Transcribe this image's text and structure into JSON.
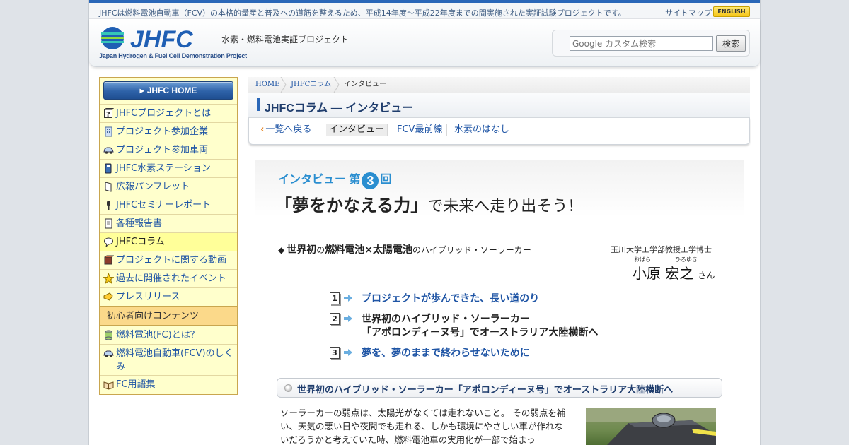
{
  "topbar": {
    "lead": "JHFCは燃料電池自動車（FCV）の本格的量産と普及への道筋を整えるため、平成14年度～平成22年度までの間実施された実証試験プロジェクトです。",
    "sitemap": "サイトマップ",
    "english": "ENGLISH"
  },
  "header": {
    "logo_text": "JHFC",
    "logo_sub": "Japan Hydrogen & Fuel Cell Demonstration Project",
    "logo_jp": "水素・燃料電池実証プロジェクト",
    "search_placeholder": "Google カスタム検索",
    "search_button": "検索"
  },
  "sidebar": {
    "home": "JHFC HOME",
    "items": [
      {
        "label": "JHFCプロジェクトとは",
        "icon": "question-cube-icon"
      },
      {
        "label": "プロジェクト参加企業",
        "icon": "building-icon"
      },
      {
        "label": "プロジェクト参加車両",
        "icon": "car-icon"
      },
      {
        "label": "JHFC水素ステーション",
        "icon": "station-icon"
      },
      {
        "label": "広報パンフレット",
        "icon": "pamphlet-icon"
      },
      {
        "label": "JHFCセミナーレポート",
        "icon": "microphone-icon"
      },
      {
        "label": "各種報告書",
        "icon": "document-icon"
      },
      {
        "label": "JHFCコラム",
        "icon": "speech-bubble-icon"
      },
      {
        "label": "プロジェクトに関する動画",
        "icon": "video-cube-icon"
      },
      {
        "label": "過去に開催されたイベント",
        "icon": "star-icon"
      },
      {
        "label": "プレスリリース",
        "icon": "megaphone-icon"
      }
    ],
    "section": "初心者向けコンテンツ",
    "beginner_items": [
      {
        "label": "燃料電池(FC)とは？",
        "icon": "fuel-cell-icon"
      },
      {
        "label": "燃料電池自動車(FCV)のしくみ",
        "icon": "car-icon"
      },
      {
        "label": "FC用語集",
        "icon": "book-icon"
      }
    ]
  },
  "breadcrumb": [
    "HOME",
    "JHFCコラム",
    "インタビュー"
  ],
  "page_title": "JHFCコラム ― インタビュー",
  "subnav": {
    "back": "一覧へ戻る",
    "items": [
      "インタビュー",
      "FCV最前線",
      "水素のはなし"
    ]
  },
  "banner": {
    "label_pre": "インタビュー 第",
    "number": "3",
    "label_post": "回",
    "headline_big": "「夢をかなえる力」",
    "headline_rest": "で未来へ走り出そう！"
  },
  "feature": {
    "marker": "◆",
    "part1": "世界初",
    "part2": "の",
    "part3": "燃料電池×太陽電池",
    "part4": "のハイブリッド・ソーラーカー"
  },
  "professor": {
    "title": "玉川大学工学部教授工学博士",
    "ruby_family": "おばら",
    "ruby_given": "ひろゆき",
    "name": "小原 宏之",
    "honorific": "さん"
  },
  "toc": [
    {
      "num": "1",
      "text": "プロジェクトが歩んできた、長い道のり",
      "link": true
    },
    {
      "num": "2",
      "text": "世界初のハイブリッド・ソーラーカー",
      "text2": "「アポロンディーヌ号」でオーストラリア大陸横断へ",
      "link": false
    },
    {
      "num": "3",
      "text": "夢を、夢のままで終わらせないために",
      "link": true
    }
  ],
  "section_heading": "世界初のハイブリッド・ソーラーカー「アポロンディーヌ号」でオーストラリア大陸横断へ",
  "body": "ソーラーカーの弱点は、太陽光がなくては走れないこと。 その弱点を補い、天気の悪い日や夜間でも走れる、しかも環境にやさしい車が作れないだろうかと考えていた時、燃料電池車の実用化が一部で始まっ",
  "colors": {
    "accent": "#2a67b8",
    "link": "#1f55a5",
    "sidebar_bg": "#ffffcc",
    "banner_blue": "#2a8ed0"
  }
}
